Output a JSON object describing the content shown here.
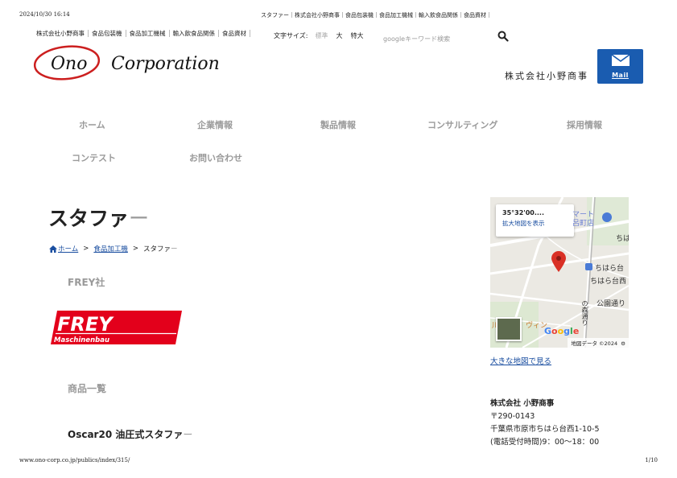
{
  "print": {
    "datetime": "2024/10/30 16:14",
    "doc_title": "スタファー｜株式会社小野商事｜食品包装機｜食品加工機械｜輸入飲食品関係｜食品資材｜",
    "url": "www.ono-corp.co.jp/publics/index/315/",
    "page": "1/10"
  },
  "top_links": [
    "株式会社小野商事",
    "食品包装機",
    "食品加工機械",
    "輸入飲食品関係",
    "食品資材"
  ],
  "font_size": {
    "label": "文字サイズ:",
    "standard": "標準",
    "large": "大",
    "xlarge": "特大"
  },
  "search": {
    "placeholder": "googleキーワード検索",
    "icon": "search-icon"
  },
  "logo": {
    "mark": "Ono",
    "wordmark": "Corporation",
    "color": "#cc1f1f"
  },
  "header": {
    "company_name": "株式会社小野商事",
    "mail_label": "Mail",
    "mail_color": "#1a5cb0"
  },
  "nav": [
    "ホーム",
    "企業情報",
    "製品情報",
    "コンサルティング",
    "採用情報",
    "コンテスト",
    "お問い合わせ"
  ],
  "page": {
    "title": "スタファ",
    "title_dash": "ー"
  },
  "breadcrumb": {
    "home": "ホーム",
    "category": "食品加工機",
    "current_main": "スタファ",
    "current_dash": "ー",
    "separator": ">"
  },
  "content": {
    "maker": "FREY社",
    "frey_logo_main": "FREY",
    "frey_logo_sub": "Maschinenbau",
    "frey_color": "#e3001b",
    "product_list_heading": "商品一覧",
    "product_title": "Oscar20 油圧式スタファ",
    "product_title_dash": "ー"
  },
  "map": {
    "coord": "35°32'00....",
    "enlarge": "拡大地図を表示",
    "labels": {
      "mart1": "マート",
      "mart2": "呂町店",
      "chiha": "ちは",
      "station1": "ちはら台",
      "station2": "ちはら台西",
      "park": "公園通り",
      "road": "の森通り",
      "vine": "ヴィン",
      "left_char": "川"
    },
    "google": [
      "G",
      "o",
      "o",
      "g",
      "l",
      "e"
    ],
    "footer": "地図データ ©2024",
    "pin_color": "#d93025"
  },
  "bigmap_link": "大きな地図で見る",
  "address": {
    "company": "株式会社 小野商事",
    "postal": "〒290-0143",
    "street": "千葉県市原市ちはら台西1-10-5",
    "hours": "(電話受付時間)9：00〜18：00"
  }
}
